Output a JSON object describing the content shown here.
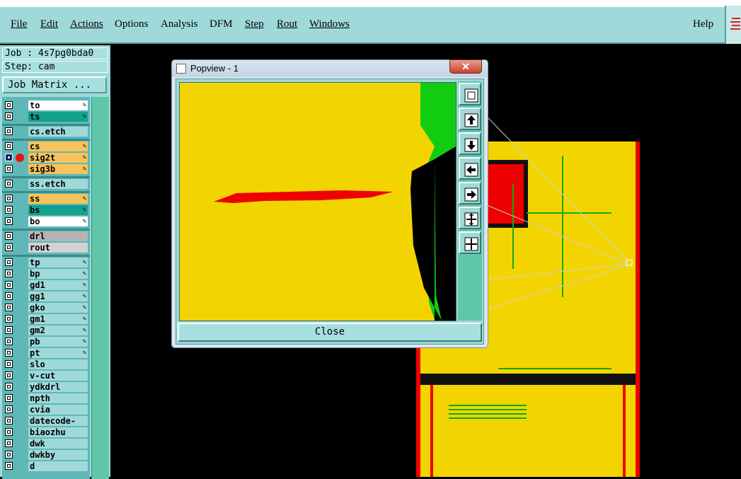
{
  "menubar": {
    "items": [
      {
        "label": "File",
        "underline": true
      },
      {
        "label": "Edit",
        "underline": true
      },
      {
        "label": "Actions",
        "underline": true
      },
      {
        "label": "Options",
        "underline": false
      },
      {
        "label": "Analysis",
        "underline": false
      },
      {
        "label": "DFM",
        "underline": false
      },
      {
        "label": "Step",
        "underline": true
      },
      {
        "label": "Rout",
        "underline": true
      },
      {
        "label": "Windows",
        "underline": true
      }
    ],
    "help_label": "Help"
  },
  "job_panel": {
    "job_line": "Job : 4s7pg0bda0",
    "step_line": "Step: cam",
    "job_matrix_label": "Job Matrix ..."
  },
  "layers": [
    {
      "name": "to",
      "bg": "#ffffff",
      "pen": true,
      "group": 0
    },
    {
      "name": "ts",
      "bg": "#14a08a",
      "pen": true,
      "group": 0
    },
    {
      "name": "cs.etch",
      "bg": "#9fd9d9",
      "pen": false,
      "group": 1
    },
    {
      "name": "cs",
      "bg": "#f7c35a",
      "pen": true,
      "group": 2
    },
    {
      "name": "sig2t",
      "bg": "#f7c35a",
      "pen": true,
      "group": 2,
      "selected": true,
      "dot": "#ee1111"
    },
    {
      "name": "sig3b",
      "bg": "#f7c35a",
      "pen": true,
      "group": 2
    },
    {
      "name": "ss.etch",
      "bg": "#9fd9d9",
      "pen": false,
      "group": 3
    },
    {
      "name": "ss",
      "bg": "#f7c35a",
      "pen": true,
      "group": 4
    },
    {
      "name": "bs",
      "bg": "#14a08a",
      "pen": true,
      "group": 4
    },
    {
      "name": "bo",
      "bg": "#ffffff",
      "pen": true,
      "group": 4
    },
    {
      "name": "drl",
      "bg": "#b4b4b4",
      "pen": false,
      "group": 5
    },
    {
      "name": "rout",
      "bg": "#d2d2d2",
      "pen": false,
      "group": 5
    },
    {
      "name": "tp",
      "bg": "#9fd9d9",
      "pen": true,
      "group": 6
    },
    {
      "name": "bp",
      "bg": "#9fd9d9",
      "pen": true,
      "group": 6
    },
    {
      "name": "gd1",
      "bg": "#9fd9d9",
      "pen": true,
      "group": 6
    },
    {
      "name": "gg1",
      "bg": "#9fd9d9",
      "pen": true,
      "group": 6
    },
    {
      "name": "gko",
      "bg": "#9fd9d9",
      "pen": true,
      "group": 6
    },
    {
      "name": "gm1",
      "bg": "#9fd9d9",
      "pen": true,
      "group": 6
    },
    {
      "name": "gm2",
      "bg": "#9fd9d9",
      "pen": true,
      "group": 6
    },
    {
      "name": "pb",
      "bg": "#9fd9d9",
      "pen": true,
      "group": 6
    },
    {
      "name": "pt",
      "bg": "#9fd9d9",
      "pen": true,
      "group": 6
    },
    {
      "name": "slo",
      "bg": "#9fd9d9",
      "pen": false,
      "group": 6
    },
    {
      "name": "v-cut",
      "bg": "#9fd9d9",
      "pen": false,
      "group": 6
    },
    {
      "name": "ydkdrl",
      "bg": "#9fd9d9",
      "pen": false,
      "group": 6
    },
    {
      "name": "npth",
      "bg": "#9fd9d9",
      "pen": false,
      "group": 6
    },
    {
      "name": "cvia",
      "bg": "#9fd9d9",
      "pen": false,
      "group": 6
    },
    {
      "name": "datecode-ptc",
      "bg": "#9fd9d9",
      "pen": false,
      "group": 6
    },
    {
      "name": "biaozhu",
      "bg": "#9fd9d9",
      "pen": false,
      "group": 6
    },
    {
      "name": "dwk",
      "bg": "#9fd9d9",
      "pen": false,
      "group": 6
    },
    {
      "name": "dwkby",
      "bg": "#9fd9d9",
      "pen": false,
      "group": 6
    },
    {
      "name": "d",
      "bg": "#9fd9d9",
      "pen": false,
      "group": 6
    }
  ],
  "popview": {
    "title": "Popview - 1",
    "close_label": "Close",
    "tools": [
      "zoom-to-fit-icon",
      "pan-up-icon",
      "pan-down-icon",
      "pan-left-icon",
      "pan-right-icon",
      "zoom-in-icon",
      "zoom-out-icon"
    ]
  },
  "colors": {
    "panel": "#9fd9d9",
    "copper": "#f2d500",
    "outline": "#ee0000",
    "trace": "#11aa11"
  }
}
